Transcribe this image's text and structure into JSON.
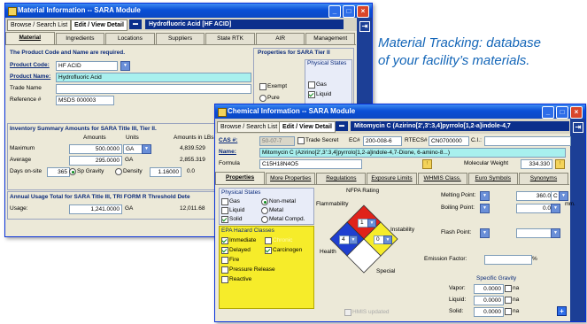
{
  "caption": {
    "line1": "Material Tracking: database",
    "line2": "of your facility’s materials."
  },
  "back_window": {
    "title": "Material Information -- SARA Module",
    "toolbar": {
      "browse_tab": "Browse / Search List",
      "edit_tab": "Edit / View Detail",
      "header_value": "Hydrofluoric Acid [HF ACID]"
    },
    "tabs": [
      "Material",
      "Ingredients",
      "Locations",
      "Suppliers",
      "State RTK",
      "AIR",
      "Management"
    ],
    "active_tab": "Material",
    "instruction": "The Product Code and Name are required.",
    "product_code_label": "Product Code:",
    "product_code_value": "HF ACID",
    "product_name_label": "Product Name:",
    "product_name_value": "Hydrofluoric Acid",
    "trade_name_label": "Trade Name",
    "reference_label": "Reference #",
    "reference_value": "MSDS 000003",
    "tier2": {
      "title": "Properties for SARA Tier II",
      "physical_states_title": "Physical States",
      "exempt": "Exempt",
      "pure": "Pure",
      "gas": "Gas",
      "liquid": "Liquid"
    },
    "inventory": {
      "title": "Inventory Summary Amounts for SARA Title III, Tier II.",
      "col_amounts": "Amounts",
      "col_units": "Units",
      "col_lbs": "Amounts in LBs",
      "maximum_label": "Maximum",
      "maximum_value": "500.0000",
      "maximum_unit": "GA",
      "maximum_lbs": "4,839.529",
      "average_label": "Average",
      "average_value": "295.0000",
      "average_unit": "GA",
      "average_lbs": "2,855.319",
      "days_label": "Days on-site",
      "days_value": "365",
      "sp_gravity": "Sp Gravity",
      "density": "Density",
      "gravity_value": "1.16000",
      "gravity_trail": "0.0"
    },
    "annual": {
      "title": "Annual Usage Total for SARA Title III, TRI FORM R Threshold Dete",
      "usage_label": "Usage:",
      "usage_value": "1,241.0000",
      "usage_unit": "GA",
      "usage_lbs": "12,011.68"
    }
  },
  "front_window": {
    "title": "Chemical Information -- SARA Module",
    "toolbar": {
      "browse_tab": "Browse / Search List",
      "edit_tab": "Edit / View Detail",
      "header_value": "Mitomycin C (Azirino[2',3':3,4]pyrrolo[1,2-a]indole-4,7"
    },
    "cas_label": "CAS #:",
    "cas_value": "50-07-7",
    "trade_secret": "Trade Secret",
    "ec_label": "EC#",
    "ec_value": "200-008-6",
    "rtecs_label": "RTECS#",
    "rtecs_value": "CN0700000",
    "ci_label": "C.I.:",
    "name_label": "Name:",
    "name_value": "Mitomycin C (Azirino[2',3':3,4]pyrrolo[1,2-a]indole-4,7-Dione, 6-amino-8...)",
    "formula_label": "Formula",
    "formula_value": "C15H18N4O5",
    "mw_label": "Molecular Weight",
    "mw_value": "334.330",
    "tabs": [
      "Properties",
      "More Properties",
      "Regulations",
      "Exposure Limits",
      "WHMIS Class.",
      "Euro Symbols",
      "Synonyms"
    ],
    "active_tab": "Properties",
    "physical_states": {
      "title": "Physical States",
      "gas": "Gas",
      "non_metal": "Non-metal",
      "liquid": "Liquid",
      "metal": "Metal",
      "solid": "Solid",
      "metal_compd": "Metal Compd."
    },
    "epa": {
      "title": "EPA Hazard Classes",
      "immediate": "Immediate",
      "chronic": "Chronic",
      "delayed": "Delayed",
      "carcinogen": "Carcinogen",
      "fire": "Fire",
      "pressure": "Pressure Release",
      "reactive": "Reactive"
    },
    "nfpa": {
      "title": "NFPA Rating",
      "flammability": "Flammability",
      "instability": "Instability",
      "health": "Health",
      "special": "Special",
      "flam_value": "1",
      "health_value": "4",
      "inst_value": "0"
    },
    "hmis": "HMIS updated",
    "right": {
      "melting_label": "Melting Point:",
      "melting_value": "360.0",
      "melting_unit": "C",
      "melting_extra": "mm.",
      "boiling_label": "Boiling Point:",
      "boiling_value": "0.0",
      "flash_label": "Flash Point:",
      "emission_label": "Emission Factor:",
      "emission_unit": "%",
      "sg_title": "Specific Gravity",
      "vapor_label": "Vapor:",
      "vapor_value": "0.0000",
      "liquid_label": "Liquid:",
      "liquid_value": "0.0000",
      "solid_label": "Solid:",
      "solid_value": "0.0000",
      "na": "na"
    }
  }
}
